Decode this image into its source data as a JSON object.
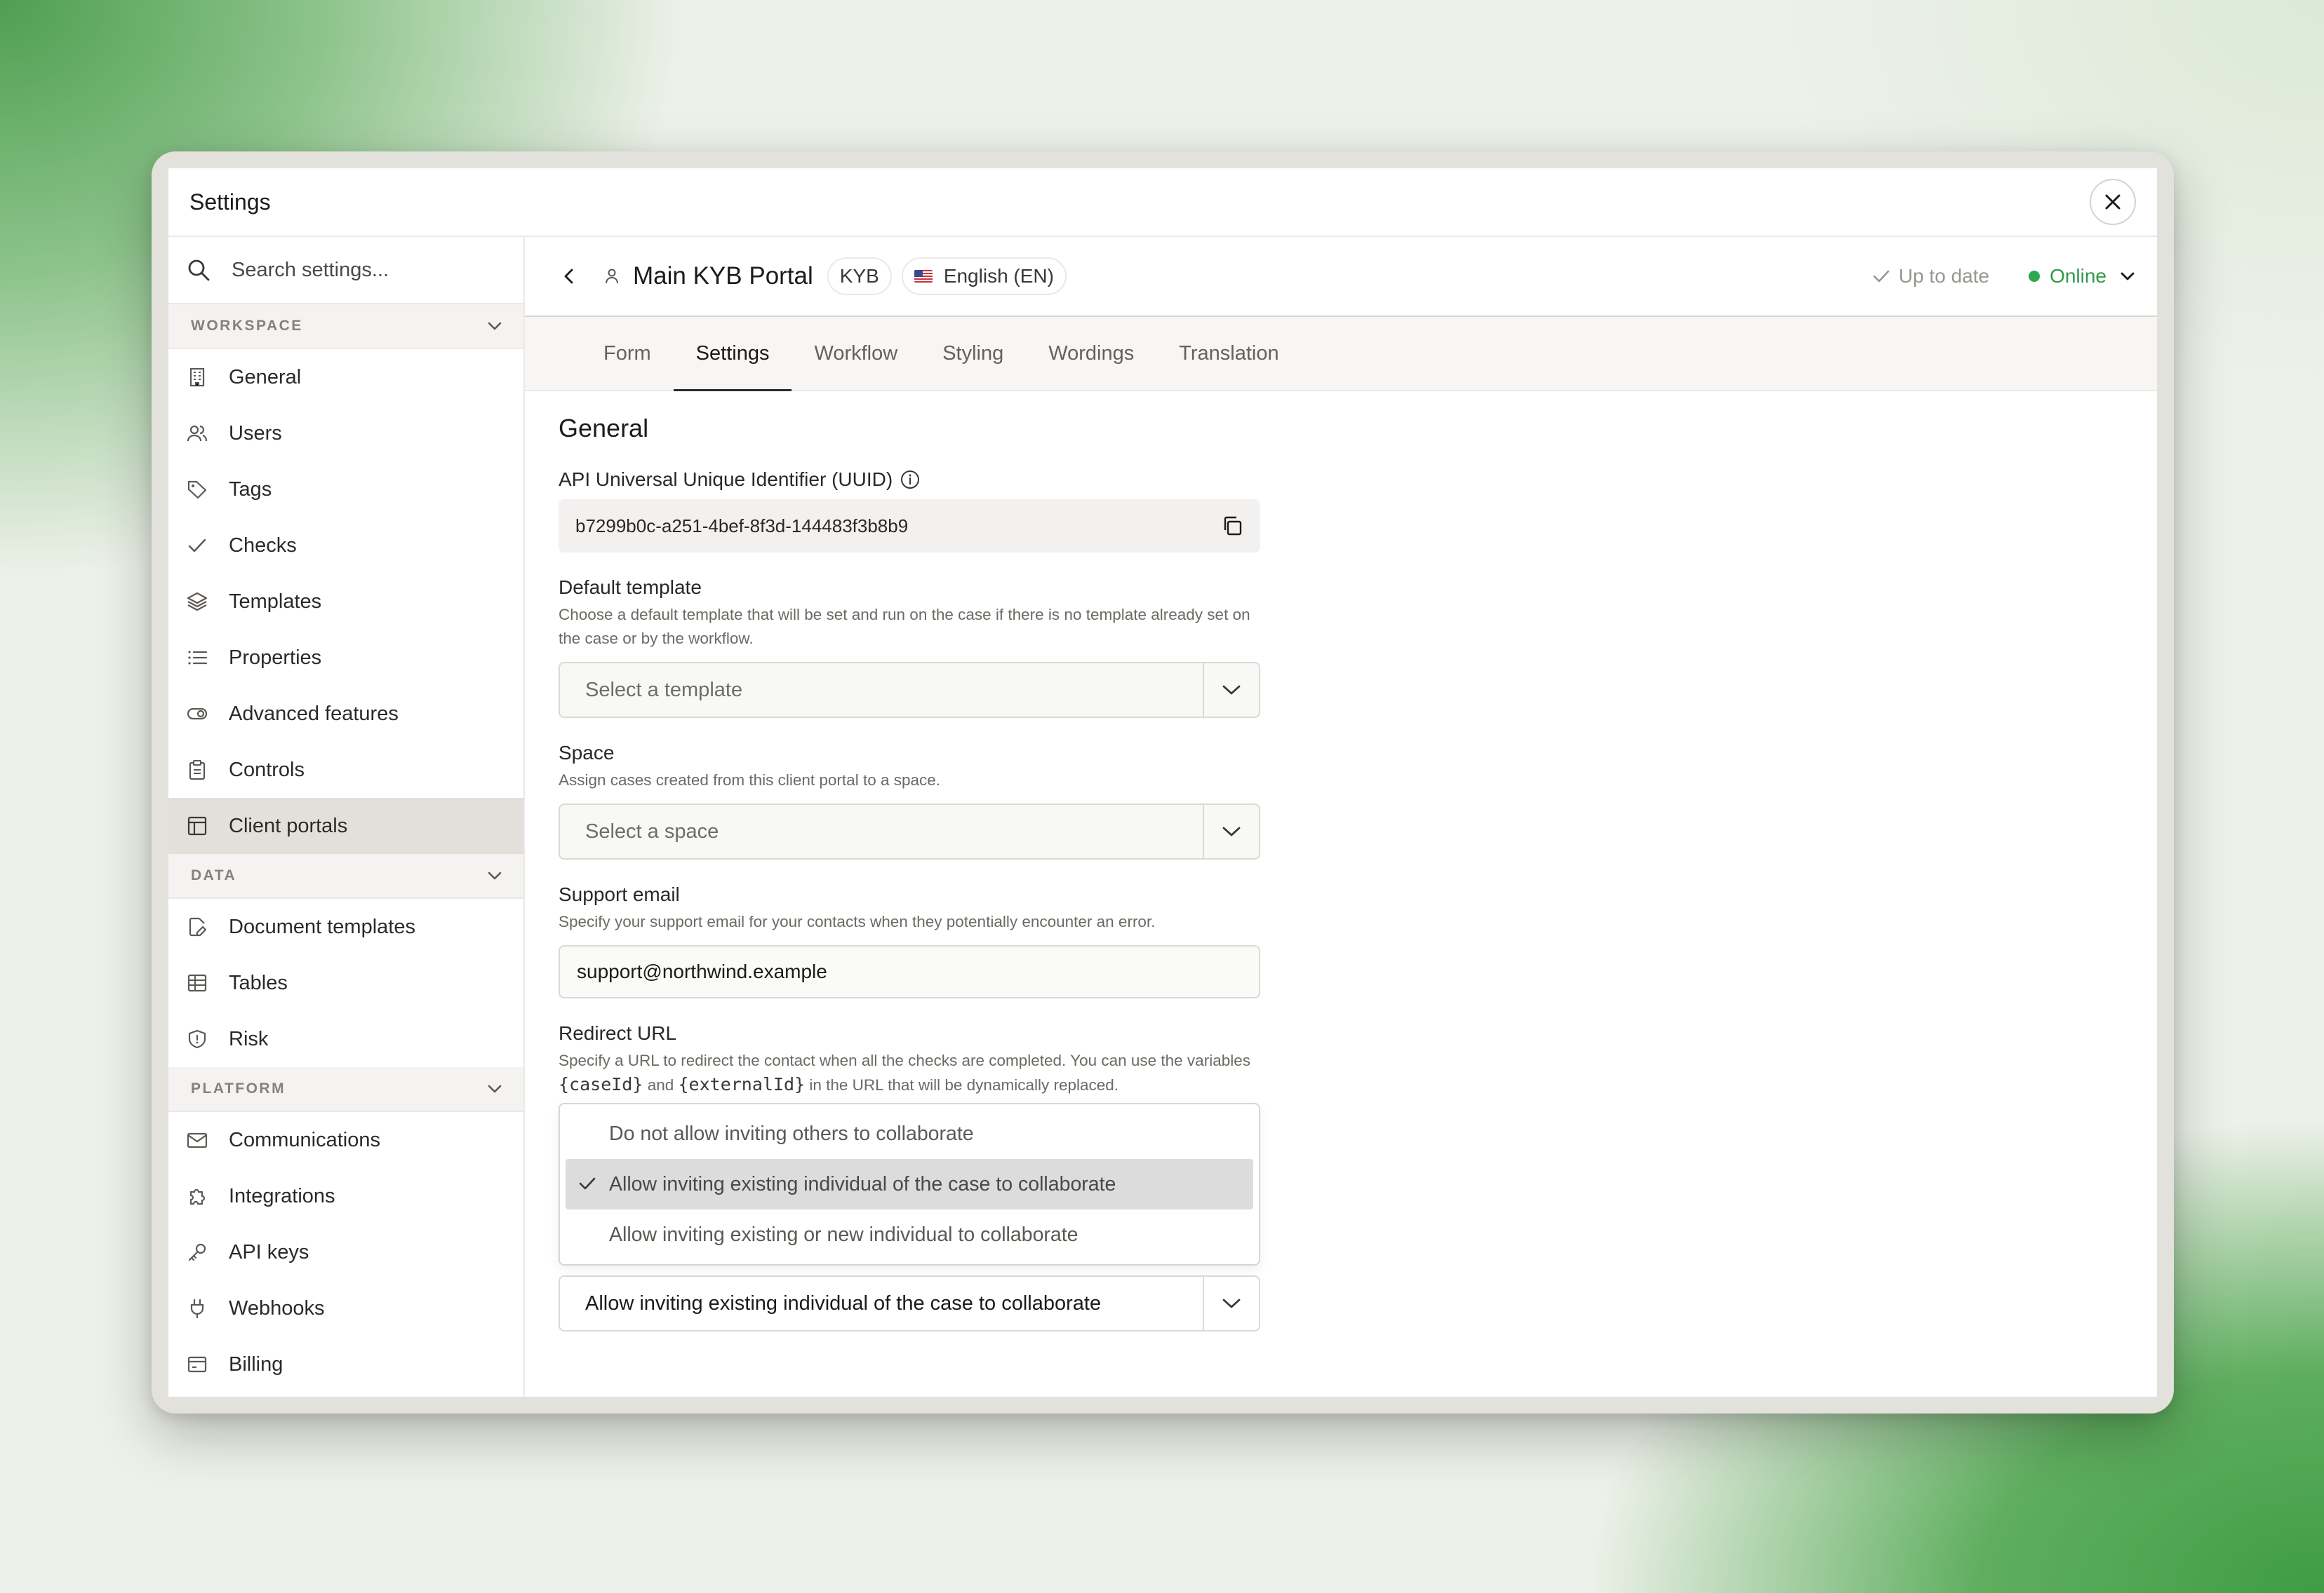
{
  "window": {
    "title": "Settings"
  },
  "sidebar": {
    "search_placeholder": "Search settings...",
    "sections": {
      "workspace": "WORKSPACE",
      "data": "DATA",
      "platform": "PLATFORM"
    },
    "workspace_items": [
      "General",
      "Users",
      "Tags",
      "Checks",
      "Templates",
      "Properties",
      "Advanced features",
      "Controls",
      "Client portals"
    ],
    "data_items": [
      "Document templates",
      "Tables",
      "Risk"
    ],
    "platform_items": [
      "Communications",
      "Integrations",
      "API keys",
      "Webhooks",
      "Billing"
    ],
    "active_item": "Client portals"
  },
  "header": {
    "portal_name": "Main KYB Portal",
    "type_chip": "KYB",
    "language_chip": "English (EN)",
    "status_text": "Up to date",
    "online_label": "Online",
    "online_color": "#2e9a48"
  },
  "tabs": [
    "Form",
    "Settings",
    "Workflow",
    "Styling",
    "Wordings",
    "Translation"
  ],
  "active_tab": "Settings",
  "general": {
    "heading": "General",
    "uuid_label": "API Universal Unique Identifier (UUID)",
    "uuid_value": "b7299b0c-a251-4bef-8f3d-144483f3b8b9",
    "default_template": {
      "label": "Default template",
      "help": "Choose a default template that will be set and run on the case if there is no template already set on the case or by the workflow.",
      "placeholder": "Select a template"
    },
    "space": {
      "label": "Space",
      "help": "Assign cases created from this client portal to a space.",
      "placeholder": "Select a space"
    },
    "support_email": {
      "label": "Support email",
      "help": "Specify your support email for your contacts when they potentially encounter an error.",
      "value": "support@northwind.example"
    },
    "redirect_url": {
      "label": "Redirect URL",
      "help_part1": "Specify a URL to redirect the contact when all the checks are completed. You can use the variables",
      "var1": "{caseId}",
      "help_and": "and",
      "var2": "{externalId}",
      "help_part2": "in the URL that will be dynamically replaced."
    },
    "collaboration": {
      "options": [
        "Do not allow inviting others to collaborate",
        "Allow inviting existing individual of the case to collaborate",
        "Allow inviting existing or new individual to collaborate"
      ],
      "selected": "Allow inviting existing individual of the case to collaborate"
    }
  }
}
